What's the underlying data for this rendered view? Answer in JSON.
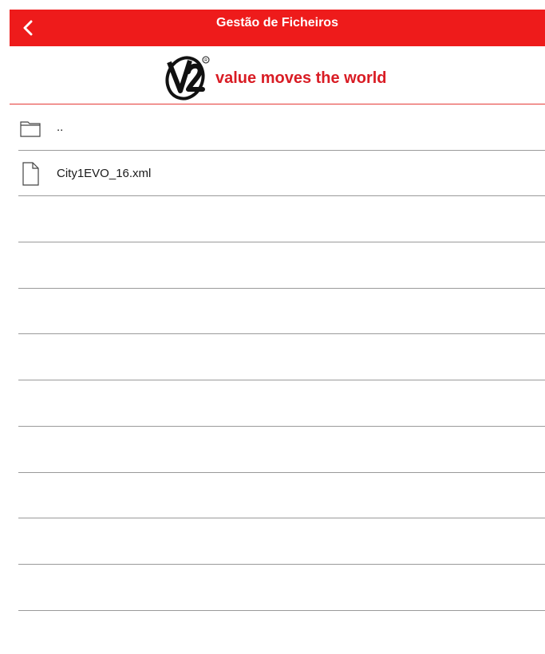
{
  "header": {
    "title": "Gestão de Ficheiros",
    "back_icon": "chevron-left-icon",
    "background": "#ee1b1b"
  },
  "logo": {
    "mark_text": "V2",
    "registered": "®",
    "tagline": "value moves the world",
    "brand_color": "#d91c24"
  },
  "files": [
    {
      "name": "..",
      "icon": "folder-icon"
    },
    {
      "name": "City1EVO_16.xml",
      "icon": "document-icon"
    },
    {
      "name": "",
      "icon": ""
    },
    {
      "name": "",
      "icon": ""
    },
    {
      "name": "",
      "icon": ""
    },
    {
      "name": "",
      "icon": ""
    },
    {
      "name": "",
      "icon": ""
    },
    {
      "name": "",
      "icon": ""
    },
    {
      "name": "",
      "icon": ""
    },
    {
      "name": "",
      "icon": ""
    },
    {
      "name": "",
      "icon": ""
    }
  ]
}
